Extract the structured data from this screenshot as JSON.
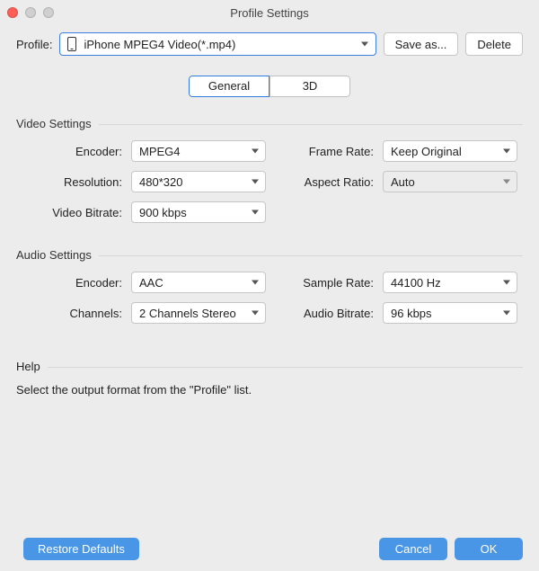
{
  "window": {
    "title": "Profile Settings"
  },
  "profile": {
    "label": "Profile:",
    "selected": "iPhone MPEG4 Video(*.mp4)",
    "save_as_label": "Save as...",
    "delete_label": "Delete"
  },
  "tabs": {
    "general": "General",
    "three_d": "3D",
    "active": "general"
  },
  "video": {
    "section_title": "Video Settings",
    "encoder_label": "Encoder:",
    "encoder_value": "MPEG4",
    "resolution_label": "Resolution:",
    "resolution_value": "480*320",
    "bitrate_label": "Video Bitrate:",
    "bitrate_value": "900 kbps",
    "framerate_label": "Frame Rate:",
    "framerate_value": "Keep Original",
    "aspect_label": "Aspect Ratio:",
    "aspect_value": "Auto"
  },
  "audio": {
    "section_title": "Audio Settings",
    "encoder_label": "Encoder:",
    "encoder_value": "AAC",
    "channels_label": "Channels:",
    "channels_value": "2 Channels Stereo",
    "samplerate_label": "Sample Rate:",
    "samplerate_value": "44100 Hz",
    "bitrate_label": "Audio Bitrate:",
    "bitrate_value": "96 kbps"
  },
  "help": {
    "title": "Help",
    "text": "Select the output format from the \"Profile\" list."
  },
  "footer": {
    "restore_label": "Restore Defaults",
    "cancel_label": "Cancel",
    "ok_label": "OK"
  }
}
